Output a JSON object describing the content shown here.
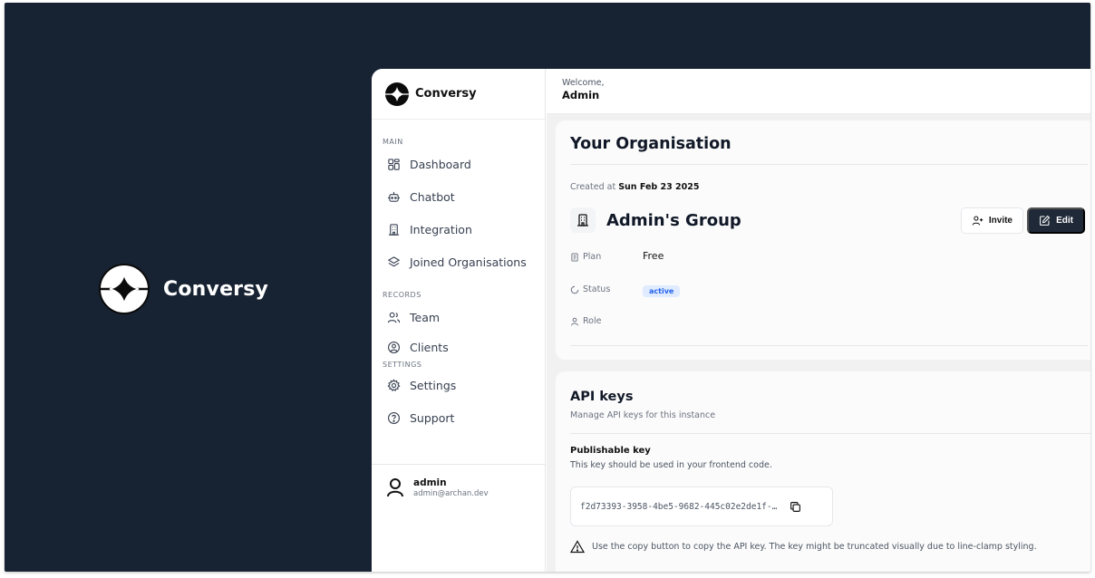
{
  "brand": {
    "name": "Conversy"
  },
  "sidebar": {
    "app_name": "Conversy",
    "sections": {
      "main": "MAIN",
      "records": "RECORDS",
      "settings": "SETTINGS"
    },
    "items": {
      "dashboard": "Dashboard",
      "chatbot": "Chatbot",
      "integration": "Integration",
      "joined": "Joined Organisations",
      "team": "Team",
      "clients": "Clients",
      "settings": "Settings",
      "support": "Support"
    },
    "user": {
      "name": "admin",
      "email": "admin@archan.dev"
    }
  },
  "header": {
    "welcome": "Welcome,",
    "user": "Admin"
  },
  "organisation": {
    "title": "Your Organisation",
    "created_prefix": "Created at",
    "created_date": "Sun Feb 23 2025",
    "group_name": "Admin's Group",
    "invite_label": "Invite",
    "edit_label": "Edit",
    "plan_label": "Plan",
    "plan_value": "Free",
    "status_label": "Status",
    "status_value": "active",
    "role_label": "Role"
  },
  "api_keys": {
    "title": "API keys",
    "subtitle": "Manage API keys for this instance",
    "publishable_title": "Publishable key",
    "publishable_desc": "This key should be used in your frontend code.",
    "key_value": "f2d73393-3958-4be5-9682-445c02e2de1f-…",
    "warning": "Use the copy button to copy the API key. The key might be truncated visually due to line-clamp styling."
  },
  "colors": {
    "background": "#172232",
    "primary_button": "#1f2937",
    "status_badge": "#2563eb"
  }
}
